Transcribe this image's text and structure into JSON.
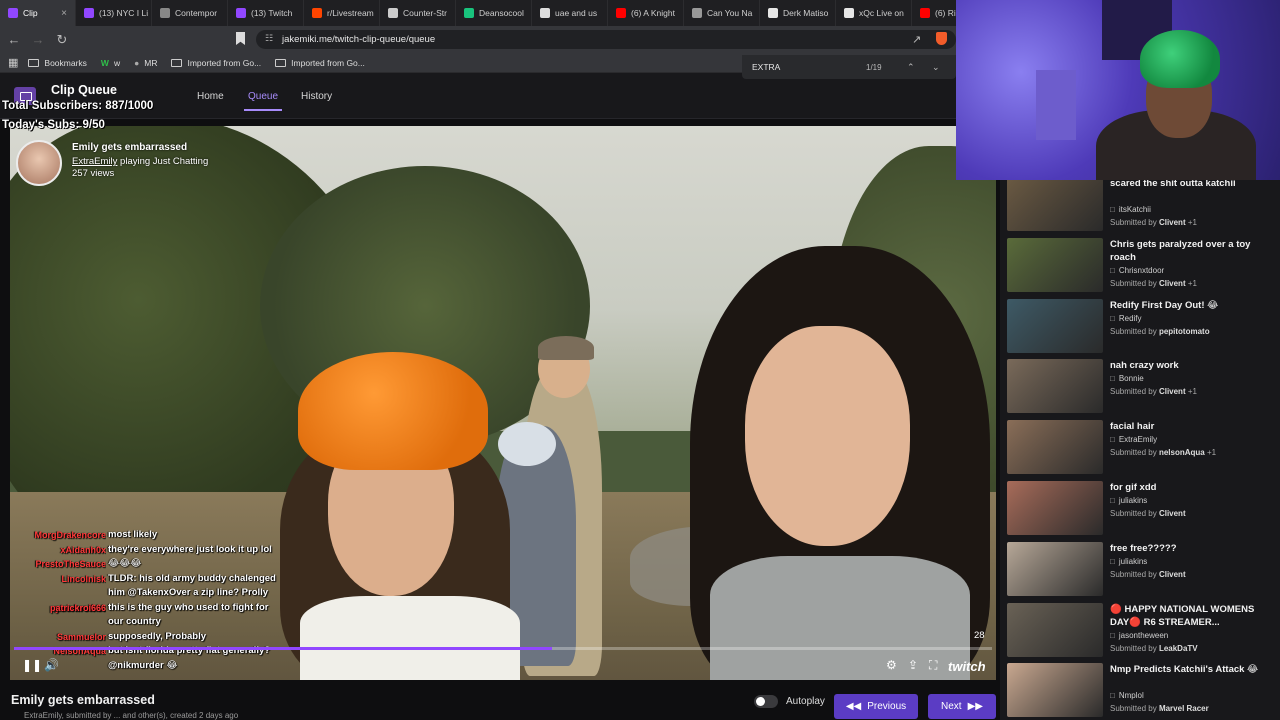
{
  "browser": {
    "tabs": [
      {
        "label": "Clip",
        "color": "#9147ff"
      },
      {
        "label": "(13) NYC I Li",
        "color": "#9147ff"
      },
      {
        "label": "Contempor",
        "color": "#888888"
      },
      {
        "label": "(13) Twitch",
        "color": "#9147ff"
      },
      {
        "label": "r/Livestream",
        "color": "#ff4500"
      },
      {
        "label": "Counter-Str",
        "color": "#cccccc"
      },
      {
        "label": "Deansocool",
        "color": "#19c37d"
      },
      {
        "label": "uae and us",
        "color": "#dddddd"
      },
      {
        "label": "(6) A Knight",
        "color": "#ff0000"
      },
      {
        "label": "Can You Na",
        "color": "#999999"
      },
      {
        "label": "Derk Matiso",
        "color": "#e6e6e6"
      },
      {
        "label": "xQc Live on",
        "color": "#e6e6e6"
      },
      {
        "label": "(6) Ri",
        "color": "#ff0000"
      }
    ],
    "url": "jakemiki.me/twitch-clip-queue/queue",
    "bookmarks": [
      "Bookmarks",
      "w",
      "MR",
      "Imported from Go...",
      "Imported from Go..."
    ],
    "find": {
      "query": "EXTRA",
      "count": "1/19"
    }
  },
  "app": {
    "title": "Clip Queue",
    "nav": [
      "Home",
      "Queue",
      "History"
    ],
    "overlay_total_subs": "Total Subscribers: 887/1000",
    "overlay_today_subs": "Today's Subs: 9/50"
  },
  "clip": {
    "title": "Emily gets embarrassed",
    "channel": "ExtraEmily",
    "playing": "playing Just Chatting",
    "views": "257 views",
    "time": "28",
    "progress": 0.55,
    "bottom_title": "Emily gets embarrassed",
    "bottom_meta": "ExtraEmily, submitted by ... and other(s), created 2 days ago"
  },
  "chat": [
    {
      "name": "MorgDrakencore",
      "text": "most likely"
    },
    {
      "name": "xAidanh0x",
      "text": "they're everywhere just look it up lol"
    },
    {
      "name": "PrestoTheSauce",
      "text": "😂😂😂"
    },
    {
      "name": "Lincolnisk",
      "text": "TLDR: his old army buddy chalenged him @TakenxOver a zip line? Prolly"
    },
    {
      "name": "yourbrother",
      "text": ""
    },
    {
      "name": "patrickroi666",
      "text": "this is the guy who used to fight for our country"
    },
    {
      "name": "Sammuelor",
      "text": "supposedly, Probably"
    },
    {
      "name": "NelsonAqua",
      "text": "but isnt florida pretty flat generally?"
    },
    {
      "name": "",
      "text": "@nikmurder 😂"
    }
  ],
  "player": {
    "autoplay_label": "Autoplay",
    "prev_label": "Previous",
    "next_label": "Next",
    "brand": "twitch"
  },
  "queue": [
    {
      "title": "scared the shit outta katchii",
      "channel": "itsKatchii",
      "submitted_prefix": "Submitted by",
      "submitter": "Clivent",
      "extra": "+1",
      "thumb": "#6b5a43"
    },
    {
      "title": "Chris gets paralyzed over a toy roach",
      "channel": "Chrisnxtdoor",
      "submitted_prefix": "Submitted by",
      "submitter": "Clivent",
      "extra": "+1",
      "thumb": "#5a6b3a"
    },
    {
      "title": "Redify First Day Out! 😂",
      "channel": "Redify",
      "submitted_prefix": "Submitted by",
      "submitter": "pepitotomato",
      "extra": "",
      "thumb": "#3e5a66"
    },
    {
      "title": "nah crazy work",
      "channel": "Bonnie",
      "submitted_prefix": "Submitted by",
      "submitter": "Clivent",
      "extra": "+1",
      "thumb": "#7a6a5a"
    },
    {
      "title": "facial hair",
      "channel": "ExtraEmily",
      "submitted_prefix": "Submitted by",
      "submitter": "nelsonAqua",
      "extra": "+1",
      "thumb": "#8a6e58"
    },
    {
      "title": "for gif xdd",
      "channel": "juliakins",
      "submitted_prefix": "Submitted by",
      "submitter": "Clivent",
      "extra": "",
      "thumb": "#a86c5a"
    },
    {
      "title": "free free?????",
      "channel": "juliakins",
      "submitted_prefix": "Submitted by",
      "submitter": "Clivent",
      "extra": "",
      "thumb": "#b7a898"
    },
    {
      "title": "🔴 HAPPY NATIONAL WOMENS DAY🔴 R6 STREAMER...",
      "channel": "jasontheween",
      "submitted_prefix": "Submitted by",
      "submitter": "LeakDaTV",
      "extra": "",
      "thumb": "#6a6256"
    },
    {
      "title": "Nmp Predicts Katchii's Attack 😂",
      "channel": "Nmplol",
      "submitted_prefix": "Submitted by",
      "submitter": "Marvel Racer",
      "extra": "",
      "thumb": "#c9a890"
    }
  ]
}
